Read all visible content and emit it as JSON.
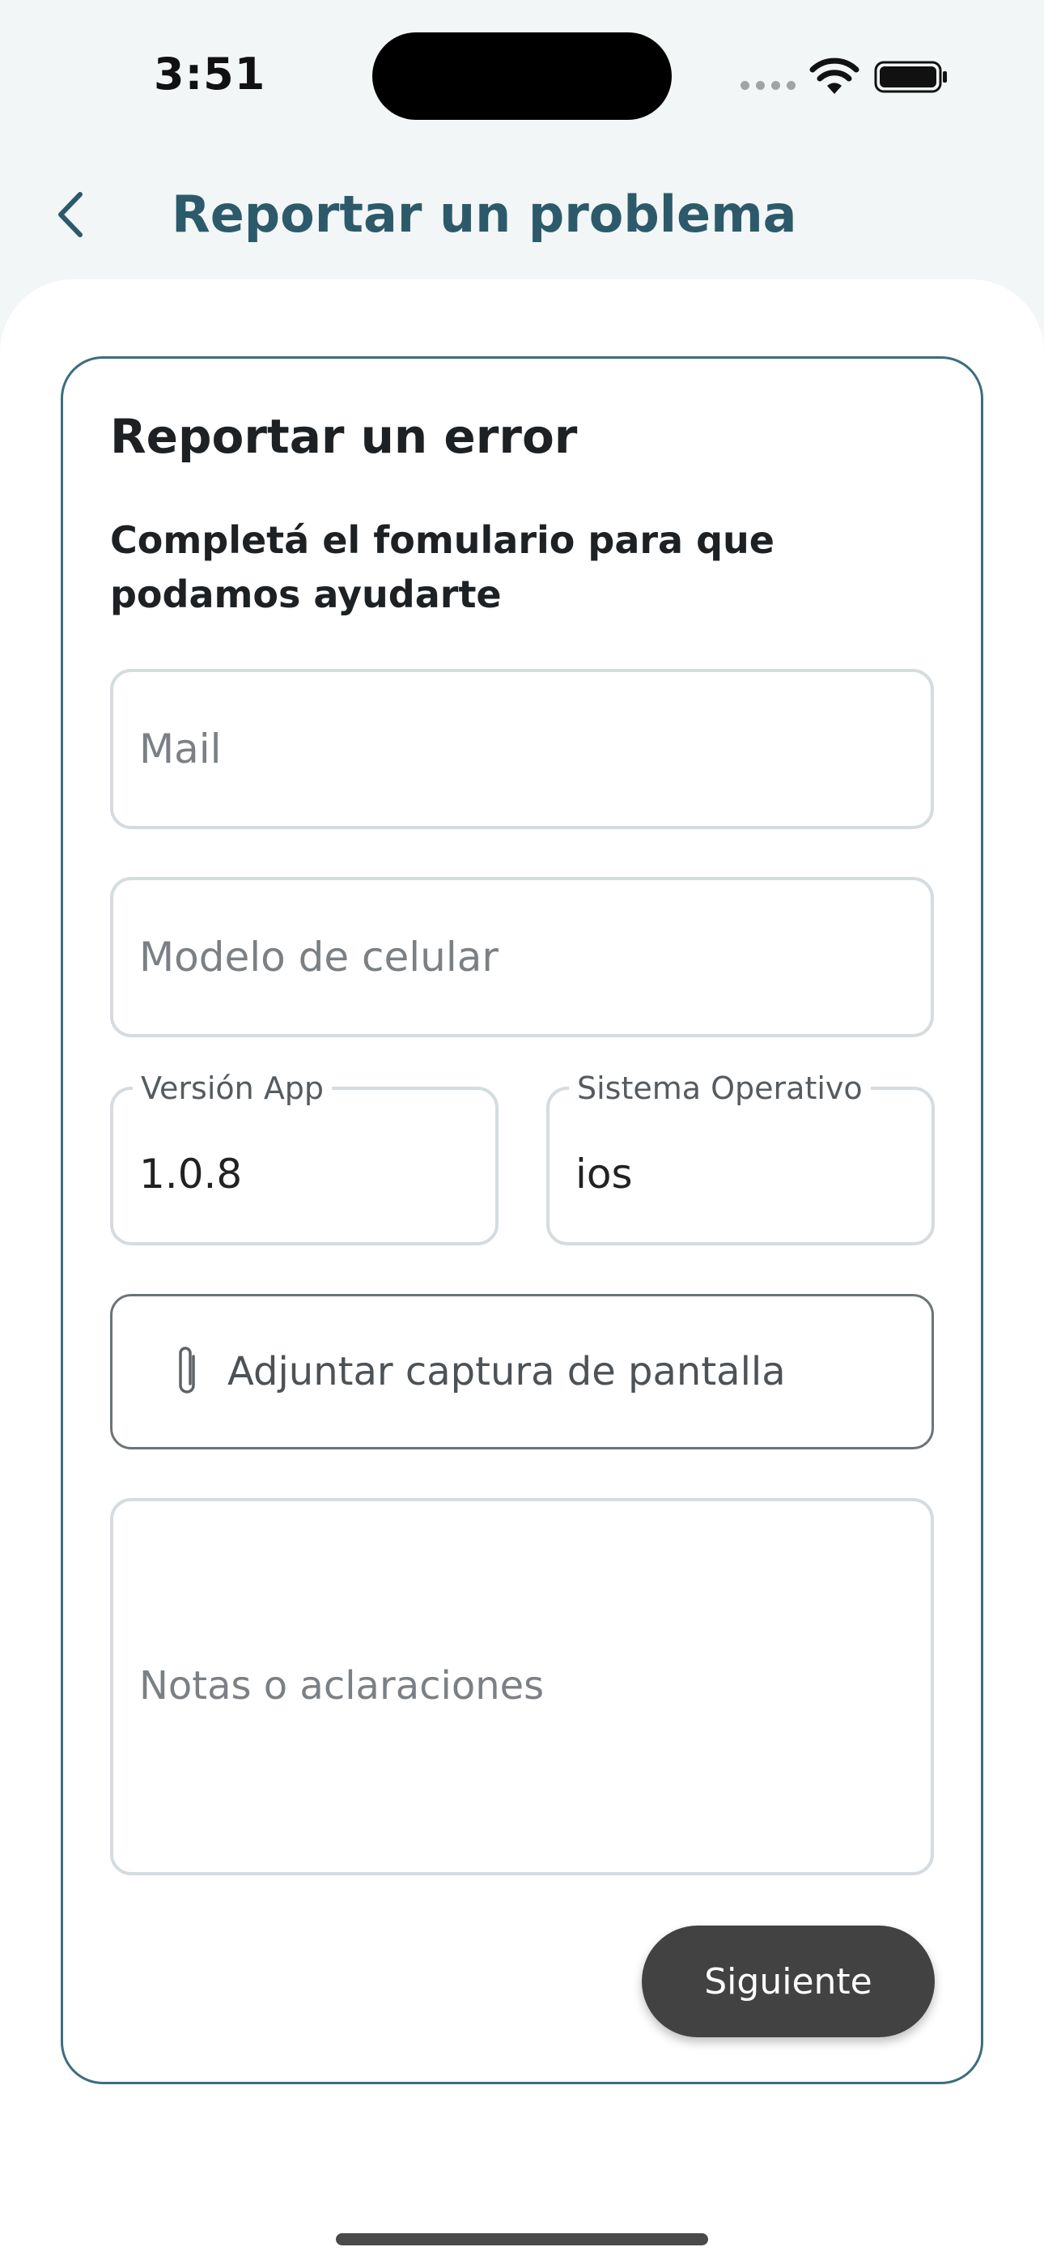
{
  "status_bar": {
    "time": "3:51"
  },
  "header": {
    "title": "Reportar un problema",
    "back_icon": "chevron-left-icon"
  },
  "form": {
    "title": "Reportar un error",
    "subtitle": "Completá el fomulario para que podamos ayudarte",
    "mail": {
      "placeholder": "Mail",
      "value": ""
    },
    "model": {
      "placeholder": "Modelo de celular",
      "value": ""
    },
    "app_version": {
      "label": "Versión App",
      "value": "1.0.8"
    },
    "os": {
      "label": "Sistema Operativo",
      "value": "ios"
    },
    "attachment": {
      "label": "Adjuntar captura de pantalla",
      "icon": "paperclip-icon"
    },
    "notes": {
      "placeholder": "Notas o aclaraciones",
      "value": ""
    },
    "submit_label": "Siguiente"
  },
  "colors": {
    "title": "#2c5a6b",
    "card_border": "#3a6e80",
    "button_bg": "#424242",
    "background": "#f2f6f6"
  }
}
